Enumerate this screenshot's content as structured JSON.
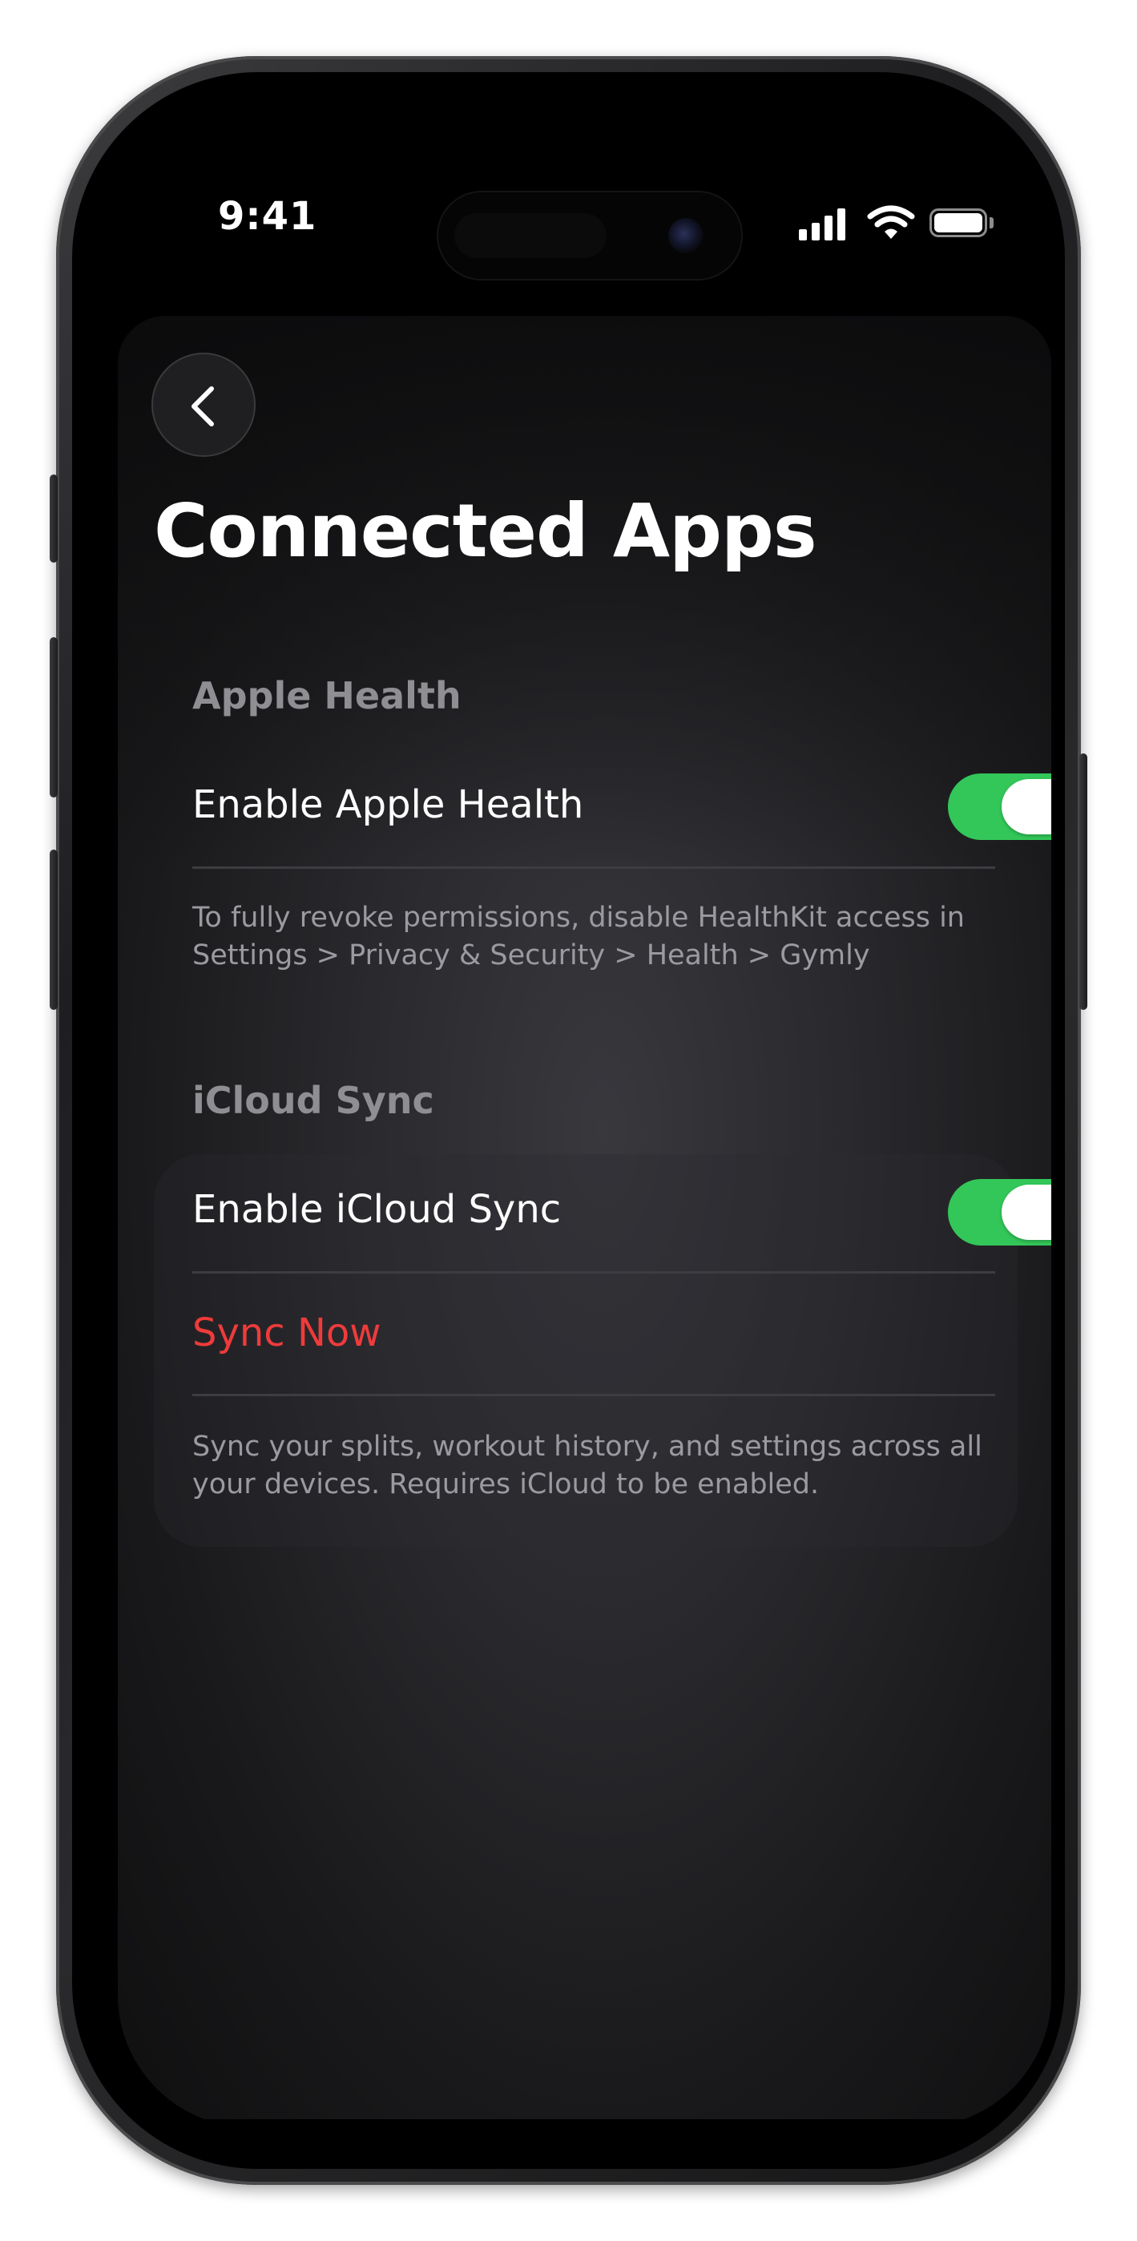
{
  "status_bar": {
    "time": "9:41",
    "signal_icon": "cellular-signal-icon",
    "wifi_icon": "wifi-icon",
    "battery_icon": "battery-icon",
    "battery_level": 1.0
  },
  "navigation": {
    "back_icon": "chevron-left-icon"
  },
  "page": {
    "title": "Connected Apps"
  },
  "apple_health": {
    "header": "Apple Health",
    "toggle_label": "Enable Apple Health",
    "toggle_on": true,
    "footnote": "To fully revoke permissions, disable HealthKit access in Settings > Privacy & Security > Health > Gymly"
  },
  "icloud_sync": {
    "header": "iCloud Sync",
    "toggle_label": "Enable iCloud Sync",
    "toggle_on": true,
    "sync_now_label": "Sync Now",
    "footnote": "Sync your splits, workout history, and settings across all your devices. Requires iCloud to be enabled."
  },
  "colors": {
    "toggle_on": "#33c759",
    "destructive": "#ef3b3b",
    "secondary_text": "#8e8e93",
    "background": "#000000"
  }
}
